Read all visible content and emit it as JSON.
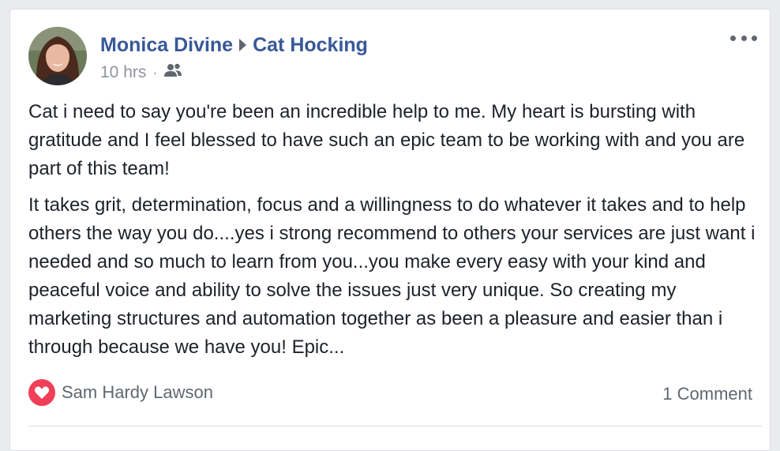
{
  "post": {
    "author": "Monica Divine",
    "target": "Cat Hocking",
    "timestamp": "10 hrs",
    "separator": "·",
    "audience_icon": "friends-icon",
    "more_icon": "more-options-icon",
    "paragraphs": [
      "Cat i need to say you're been an incredible help to me. My heart is bursting with gratitude and I feel blessed to have such an epic team to be working with and you are part of this team!",
      "It takes grit, determination, focus and a willingness to do whatever it takes and to help others the way you do....yes i strong recommend to others your services are just want i needed and so much to learn from you...you make every easy with your kind and peaceful voice and ability to solve the issues just very unique. So creating my marketing structures and automation together as been a pleasure and easier than i through because we have you! Epic..."
    ],
    "reaction_icon": "heart-icon",
    "reaction_color": "#f33e58",
    "reactor": "Sam Hardy Lawson",
    "comments": "1 Comment"
  },
  "colors": {
    "name_link": "#385898",
    "meta_gray": "#90949c",
    "background": "#e9ebee"
  }
}
